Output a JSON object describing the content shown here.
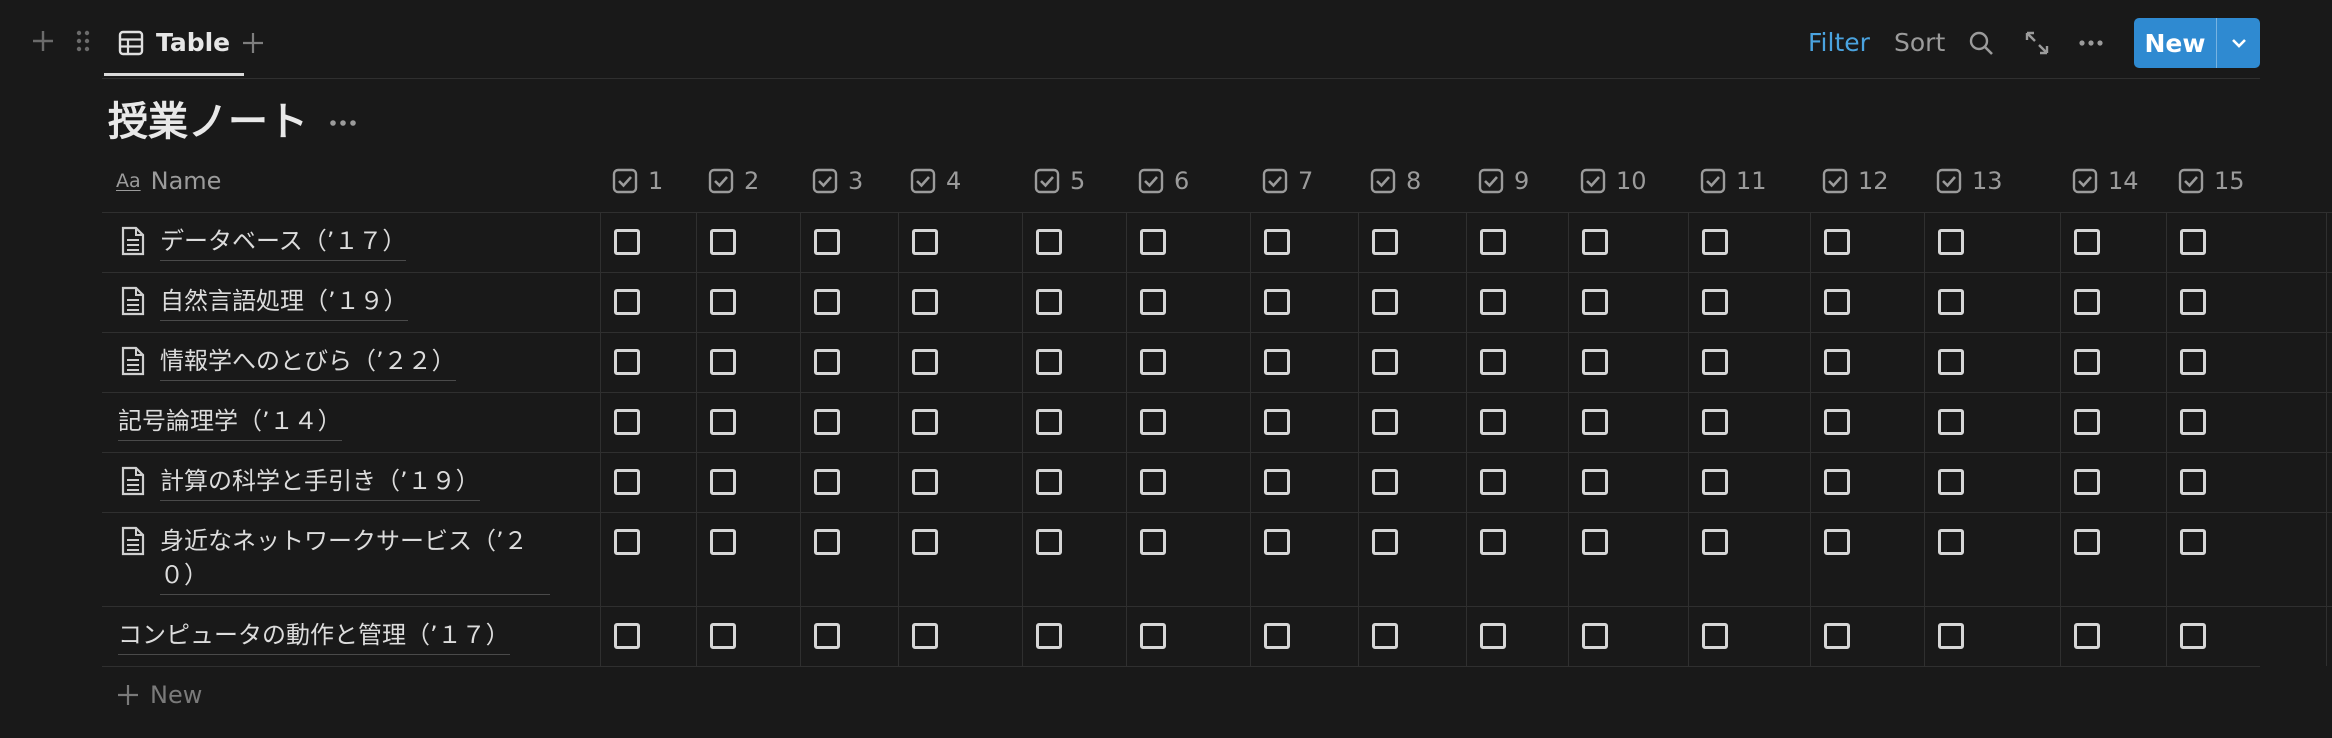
{
  "toolbar": {
    "view_tab_label": "Table",
    "filter_label": "Filter",
    "sort_label": "Sort",
    "new_label": "New",
    "accent_color": "#2f8ad1",
    "filter_color": "#4aa3df"
  },
  "database": {
    "title": "授業ノート"
  },
  "table": {
    "name_header": "Name",
    "name_header_icon": "Aa",
    "columns": [
      "1",
      "2",
      "3",
      "4",
      "5",
      "6",
      "7",
      "8",
      "9",
      "10",
      "11",
      "12",
      "13",
      "14",
      "15"
    ],
    "rows": [
      {
        "name": "データベース（’１７）",
        "has_page_icon": true,
        "checks": [
          false,
          false,
          false,
          false,
          false,
          false,
          false,
          false,
          false,
          false,
          false,
          false,
          false,
          false,
          false
        ]
      },
      {
        "name": "自然言語処理（’１９）",
        "has_page_icon": true,
        "checks": [
          false,
          false,
          false,
          false,
          false,
          false,
          false,
          false,
          false,
          false,
          false,
          false,
          false,
          false,
          false
        ]
      },
      {
        "name": "情報学へのとびら（’２２）",
        "has_page_icon": true,
        "checks": [
          false,
          false,
          false,
          false,
          false,
          false,
          false,
          false,
          false,
          false,
          false,
          false,
          false,
          false,
          false
        ]
      },
      {
        "name": "記号論理学（’１４）",
        "has_page_icon": false,
        "checks": [
          false,
          false,
          false,
          false,
          false,
          false,
          false,
          false,
          false,
          false,
          false,
          false,
          false,
          false,
          false
        ]
      },
      {
        "name": "計算の科学と手引き（’１９）",
        "has_page_icon": true,
        "checks": [
          false,
          false,
          false,
          false,
          false,
          false,
          false,
          false,
          false,
          false,
          false,
          false,
          false,
          false,
          false
        ]
      },
      {
        "name": "身近なネットワークサービス（’２０）",
        "has_page_icon": true,
        "checks": [
          false,
          false,
          false,
          false,
          false,
          false,
          false,
          false,
          false,
          false,
          false,
          false,
          false,
          false,
          false
        ]
      },
      {
        "name": "コンピュータの動作と管理（’１７）",
        "has_page_icon": false,
        "checks": [
          false,
          false,
          false,
          false,
          false,
          false,
          false,
          false,
          false,
          false,
          false,
          false,
          false,
          false,
          false
        ]
      }
    ],
    "add_row_label": "New"
  }
}
